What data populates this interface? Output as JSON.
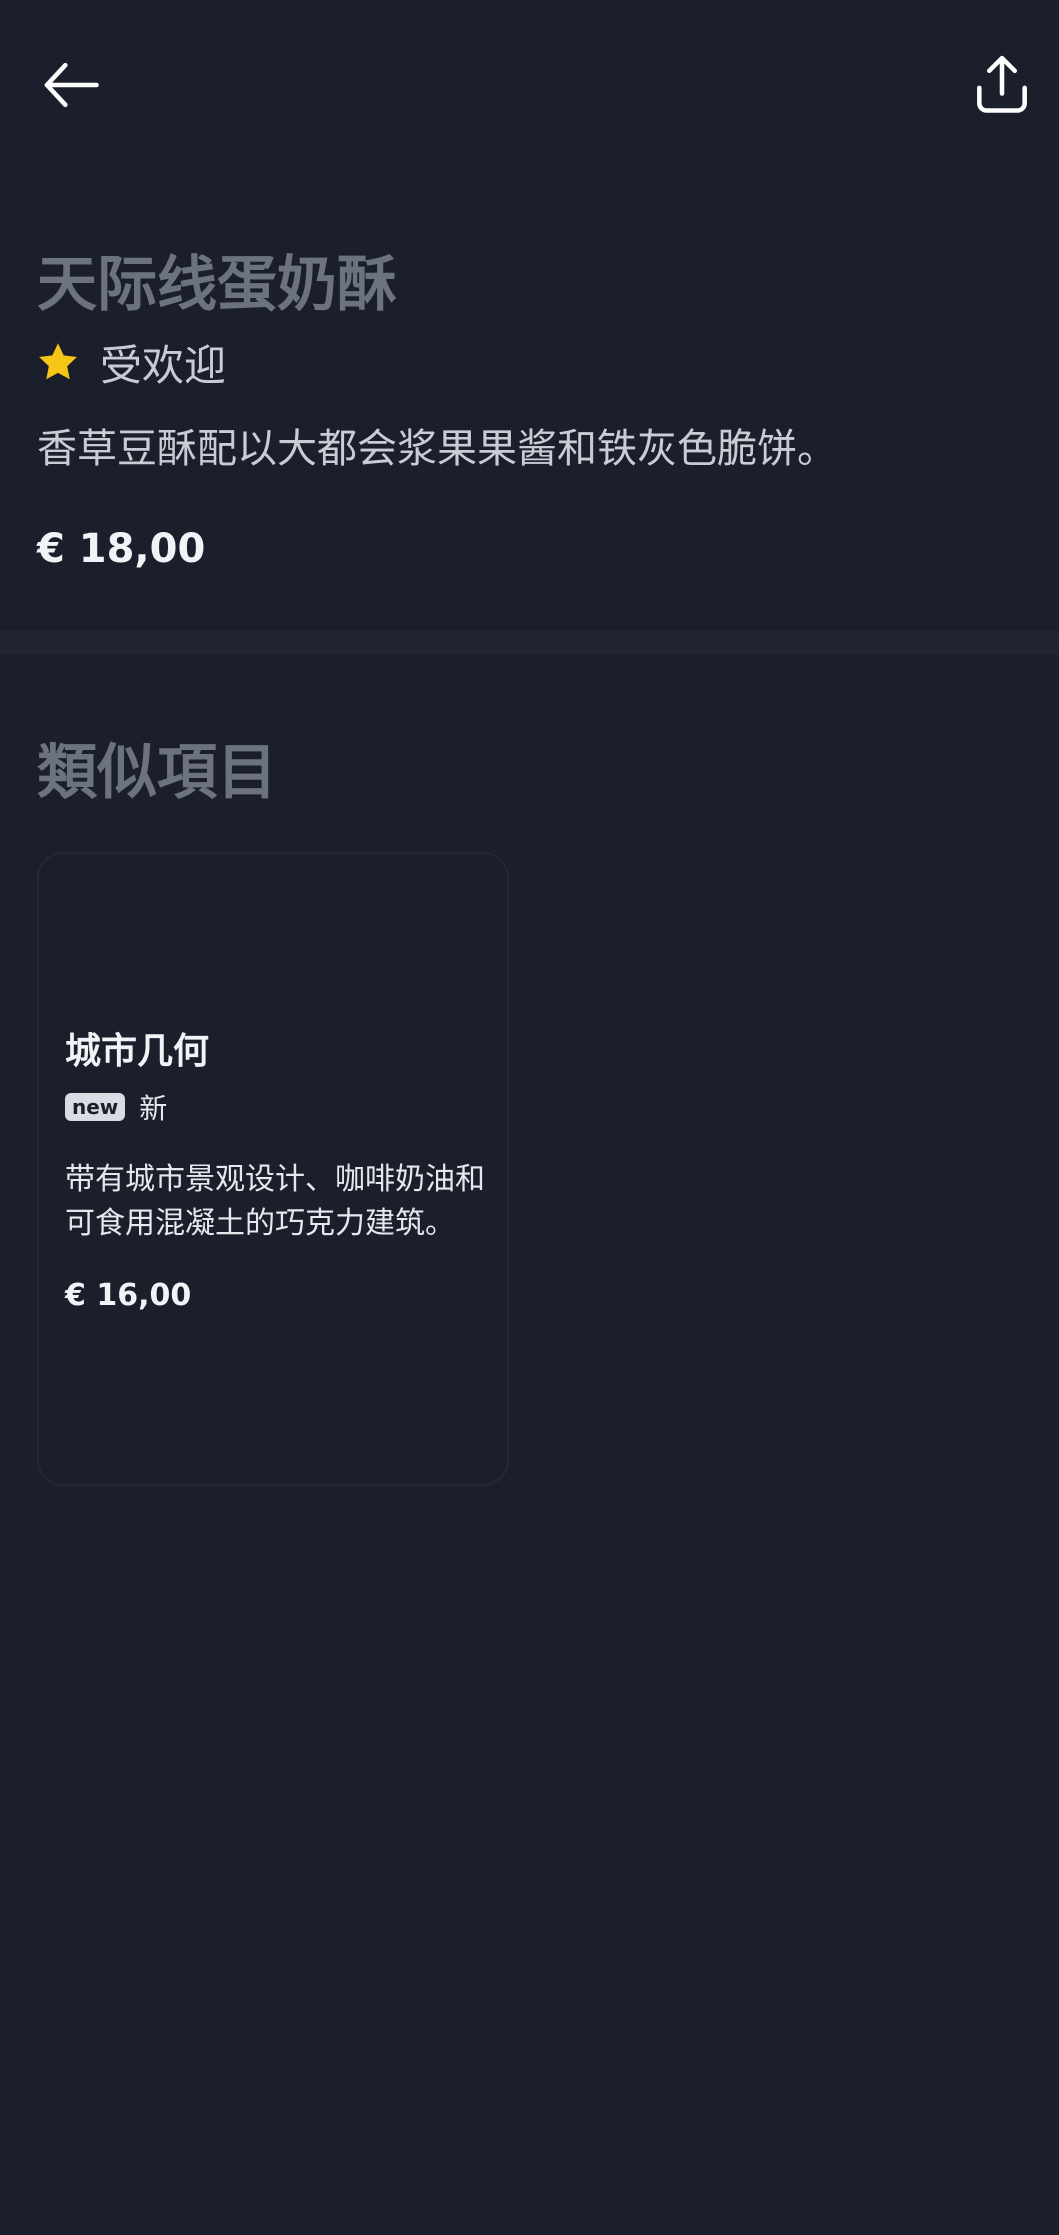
{
  "product": {
    "title": "天际线蛋奶酥",
    "badge": {
      "icon": "star-icon",
      "label": "受欢迎",
      "color": "#f5c518"
    },
    "description": "香草豆酥配以大都会浆果果酱和铁灰色脆饼。",
    "price": "€ 18,00"
  },
  "similar": {
    "title": "類似項目",
    "items": [
      {
        "title": "城市几何",
        "tag_chip": "new",
        "tag_label": "新",
        "description": "带有城市景观设计、咖啡奶油和可食用混凝土的巧克力建筑。",
        "price": "€ 16,00"
      }
    ]
  },
  "icons": {
    "back": "arrow-left-icon",
    "share": "share-icon"
  },
  "colors": {
    "background": "#1a1f2b",
    "muted_heading": "#6c7280",
    "star": "#f5c518"
  }
}
